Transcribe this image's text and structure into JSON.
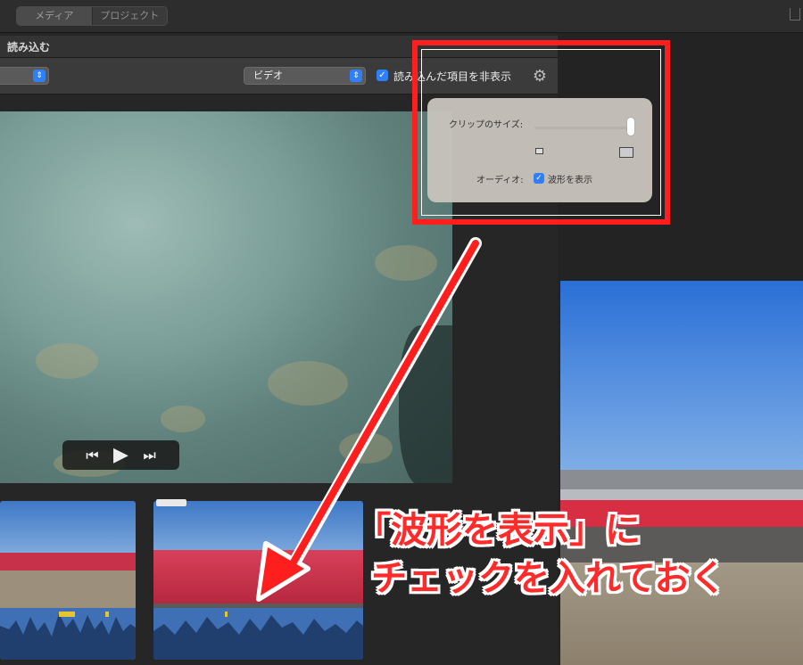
{
  "topbar": {
    "tabs": [
      "メディア",
      "プロジェクト"
    ],
    "selected": "メディア"
  },
  "import_window": {
    "title": "読み込む",
    "video_popup": "ビデオ",
    "hide_imported_label": "読み込んだ項目を非表示",
    "hide_imported_checked": true
  },
  "popover": {
    "clip_size_label": "クリップのサイズ:",
    "clip_size_value": 1.0,
    "audio_label": "オーディオ:",
    "show_waveform_label": "波形を表示",
    "show_waveform_checked": true
  },
  "annotation": {
    "line1": "「波形を表示」に",
    "line2": "チェックを入れておく",
    "color": "#ff1e1e"
  },
  "accent": "#2f7ff7"
}
